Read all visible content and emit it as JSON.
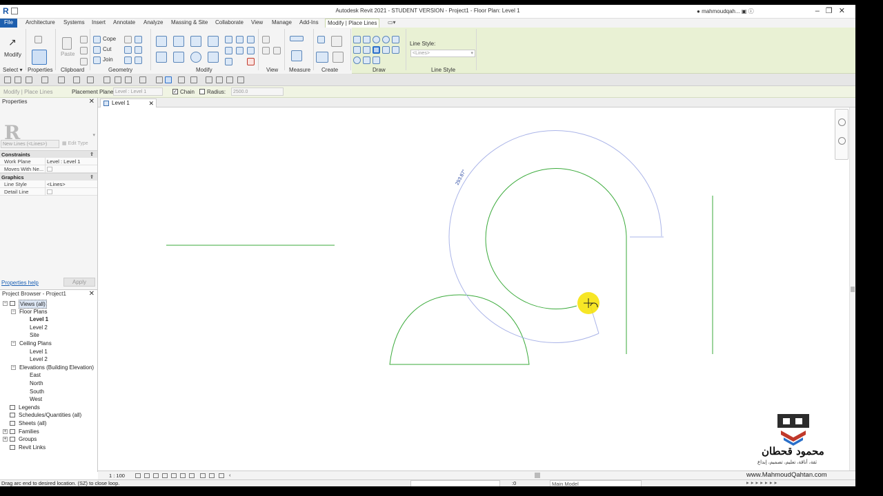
{
  "titlebar": {
    "app_title": "Autodesk Revit 2021 - STUDENT VERSION - Project1 - Floor Plan: Level 1",
    "user": "mahmoudqah...",
    "window_buttons": "–❐✕"
  },
  "menu": {
    "tabs": [
      "File",
      "Architecture",
      "Systems",
      "Insert",
      "Annotate",
      "Analyze",
      "Massing & Site",
      "Collaborate",
      "View",
      "Manage",
      "Add-Ins",
      "Modify | Place Lines"
    ],
    "active": "Modify | Place Lines"
  },
  "ribbon": {
    "modify_label": "Modify",
    "select_label": "Select ▾",
    "properties_label": "Properties",
    "clipboard_label": "Clipboard",
    "paste_label": "Paste",
    "cope_label": "Cope",
    "cut_label": "Cut",
    "join_label": "Join",
    "geometry_label": "Geometry",
    "modify_panel_label": "Modify",
    "view_label": "View",
    "measure_label": "Measure",
    "create_label": "Create",
    "draw_label": "Draw",
    "line_style_label": "Line Style",
    "line_style_title": "Line Style:",
    "line_style_value": "<Lines>"
  },
  "options_bar": {
    "context": "Modify | Place Lines",
    "placement_plane_label": "Placement Plane:",
    "placement_plane_value": "Level : Level 1",
    "chain_label": "Chain",
    "chain_checked": "✓",
    "radius_label": "Radius:",
    "radius_value": "2500.0"
  },
  "properties": {
    "header": "Properties",
    "type_letter": "R",
    "type_selector": "New Lines (<Lines>)",
    "edit_type": "Edit Type",
    "sections": [
      {
        "title": "Constraints",
        "rows": [
          {
            "key": "Work Plane",
            "value": "Level : Level 1"
          },
          {
            "key": "Moves With Ne...",
            "value": ""
          }
        ]
      },
      {
        "title": "Graphics",
        "rows": [
          {
            "key": "Line Style",
            "value": "<Lines>"
          },
          {
            "key": "Detail Line",
            "value": ""
          }
        ]
      }
    ],
    "help": "Properties help",
    "apply": "Apply"
  },
  "browser": {
    "header": "Project Browser - Project1",
    "items": [
      {
        "label": "Views (all)",
        "level": 0,
        "exp": "−"
      },
      {
        "label": "Floor Plans",
        "level": 1,
        "exp": "−"
      },
      {
        "label": "Level 1",
        "level": 2,
        "bold": true
      },
      {
        "label": "Level 2",
        "level": 2
      },
      {
        "label": "Site",
        "level": 2
      },
      {
        "label": "Ceiling Plans",
        "level": 1,
        "exp": "−"
      },
      {
        "label": "Level 1",
        "level": 2
      },
      {
        "label": "Level 2",
        "level": 2
      },
      {
        "label": "Elevations (Building Elevation)",
        "level": 1,
        "exp": "−"
      },
      {
        "label": "East",
        "level": 2
      },
      {
        "label": "North",
        "level": 2
      },
      {
        "label": "South",
        "level": 2
      },
      {
        "label": "West",
        "level": 2
      },
      {
        "label": "Legends",
        "level": 0
      },
      {
        "label": "Schedules/Quantities (all)",
        "level": 0
      },
      {
        "label": "Sheets (all)",
        "level": 0
      },
      {
        "label": "Families",
        "level": 0,
        "exp": "+"
      },
      {
        "label": "Groups",
        "level": 0,
        "exp": "+"
      },
      {
        "label": "Revit Links",
        "level": 0
      }
    ]
  },
  "view": {
    "tab_label": "Level 1",
    "dimension_text": "293.87°",
    "scale": "1 : 100"
  },
  "status": {
    "message": "Drag arc end to desired location.  (SZ) to close loop.",
    "coord": ":0",
    "model": "Main Model"
  },
  "watermark": {
    "url": "www.MahmoudQahtan.com",
    "arabic_name": "محمود قحطان",
    "arabic_tagline": "ثقة، أناقة، تعليم، تصميم، إبداع"
  },
  "colors": {
    "accent_blue": "#1e5fae",
    "ribbon_green": "#e9f1d4",
    "line_green": "#3aaa3a",
    "temp_arc": "#aab4e8",
    "cursor_yellow": "#f6e200"
  }
}
